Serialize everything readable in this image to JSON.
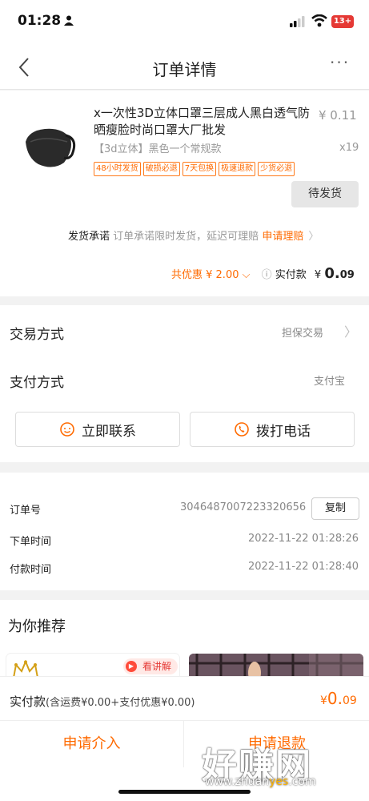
{
  "status_bar": {
    "time": "01:28",
    "battery": "13+",
    "battery_color": "#e53935"
  },
  "nav": {
    "title": "订单详情",
    "more": "···"
  },
  "product": {
    "title": "x一次性3D立体口罩三层成人黑白透气防晒瘦脸时尚口罩大厂批发",
    "price": "¥ 0.11",
    "sku": "【3d立体】黑色一个常规款",
    "qty": "x19",
    "tags": [
      "48小时发货",
      "破损必退",
      "7天包换",
      "极速退款",
      "少货必退"
    ],
    "status_button": "待发货"
  },
  "promise": {
    "label": "发货承诺",
    "text": "订单承诺限时发货，延迟可理赔",
    "link": "申请理赔"
  },
  "summary": {
    "discount": "共优惠 ¥ 2.00",
    "paid_label": "实付款",
    "paid_currency": "¥",
    "paid_int": "0.",
    "paid_dec": "09"
  },
  "trade": {
    "label": "交易方式",
    "value": "担保交易"
  },
  "payment": {
    "label": "支付方式",
    "value": "支付宝"
  },
  "contact_buttons": {
    "chat": "立即联系",
    "call": "拨打电话"
  },
  "order": {
    "number_label": "订单号",
    "number": "3046487007223320656",
    "copy": "复制",
    "order_time_label": "下单时间",
    "order_time": "2022-11-22 01:28:26",
    "pay_time_label": "付款时间",
    "pay_time": "2022-11-22 01:28:40"
  },
  "recommend": {
    "title": "为你推荐",
    "explain": "看讲解"
  },
  "bottom": {
    "pay_label": "实付款",
    "pay_detail": "(含运费¥0.00+支付优惠¥0.00)",
    "total_currency": "¥",
    "total_int": "0.",
    "total_dec": "09",
    "apply_intervene": "申请介入",
    "apply_refund": "申请退款"
  },
  "watermark": {
    "text": "好赚网",
    "url_a": "www.zhuan",
    "url_b": "yes",
    "url_c": ".com"
  },
  "accent": "#ff6a00"
}
